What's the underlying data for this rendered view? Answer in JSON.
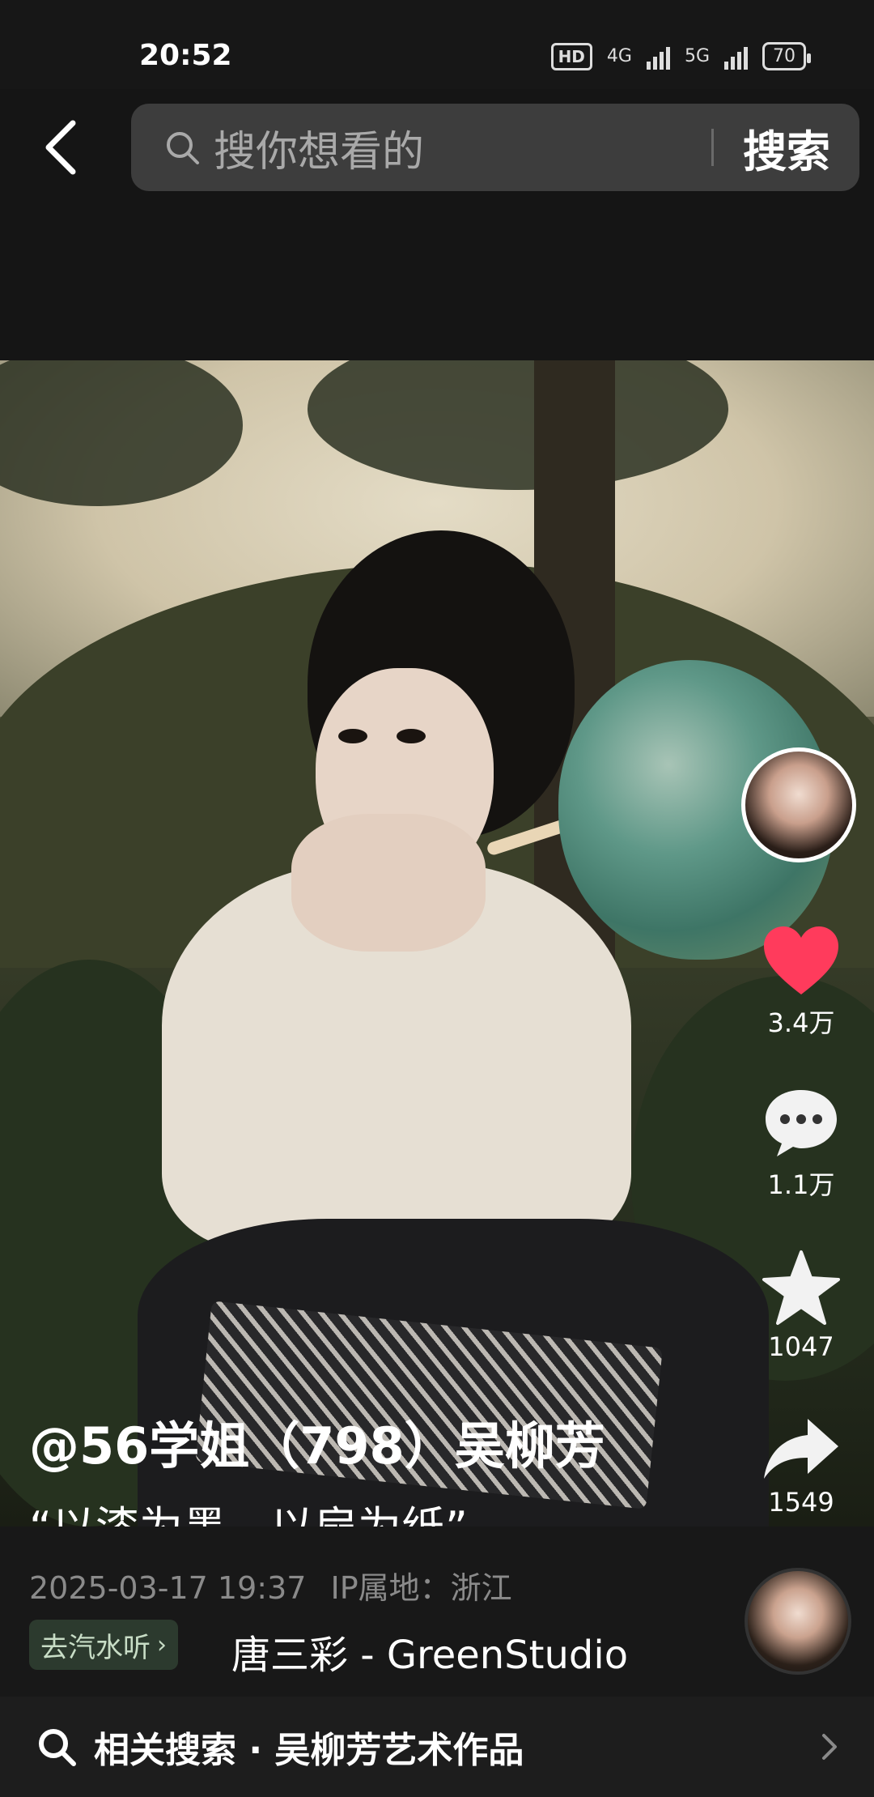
{
  "status_bar": {
    "time": "20:52",
    "hd_label": "HD",
    "network_1": "4G",
    "network_2": "5G",
    "battery": "70"
  },
  "header": {
    "back_icon": "chevron-left-icon",
    "search_placeholder": "搜你想看的",
    "search_button_label": "搜索"
  },
  "actions": {
    "like_count": "3.4万",
    "comment_count": "1.1万",
    "favorite_count": "1047",
    "share_count": "1549",
    "like_color": "#ff3b5c"
  },
  "post": {
    "author": "@56学姐（798）吴柳芳",
    "caption": "“以漆为墨，以扇为纸”",
    "date": "2025-03-17 19:37",
    "ip_location": "IP属地：浙江",
    "music_tag_label": "去汽水听",
    "music_title": "唐三彩 - GreenStudio"
  },
  "related": {
    "label": "相关搜索 · 吴柳芳艺术作品",
    "icon": "search-icon",
    "chevron_icon": "chevron-right-icon"
  }
}
